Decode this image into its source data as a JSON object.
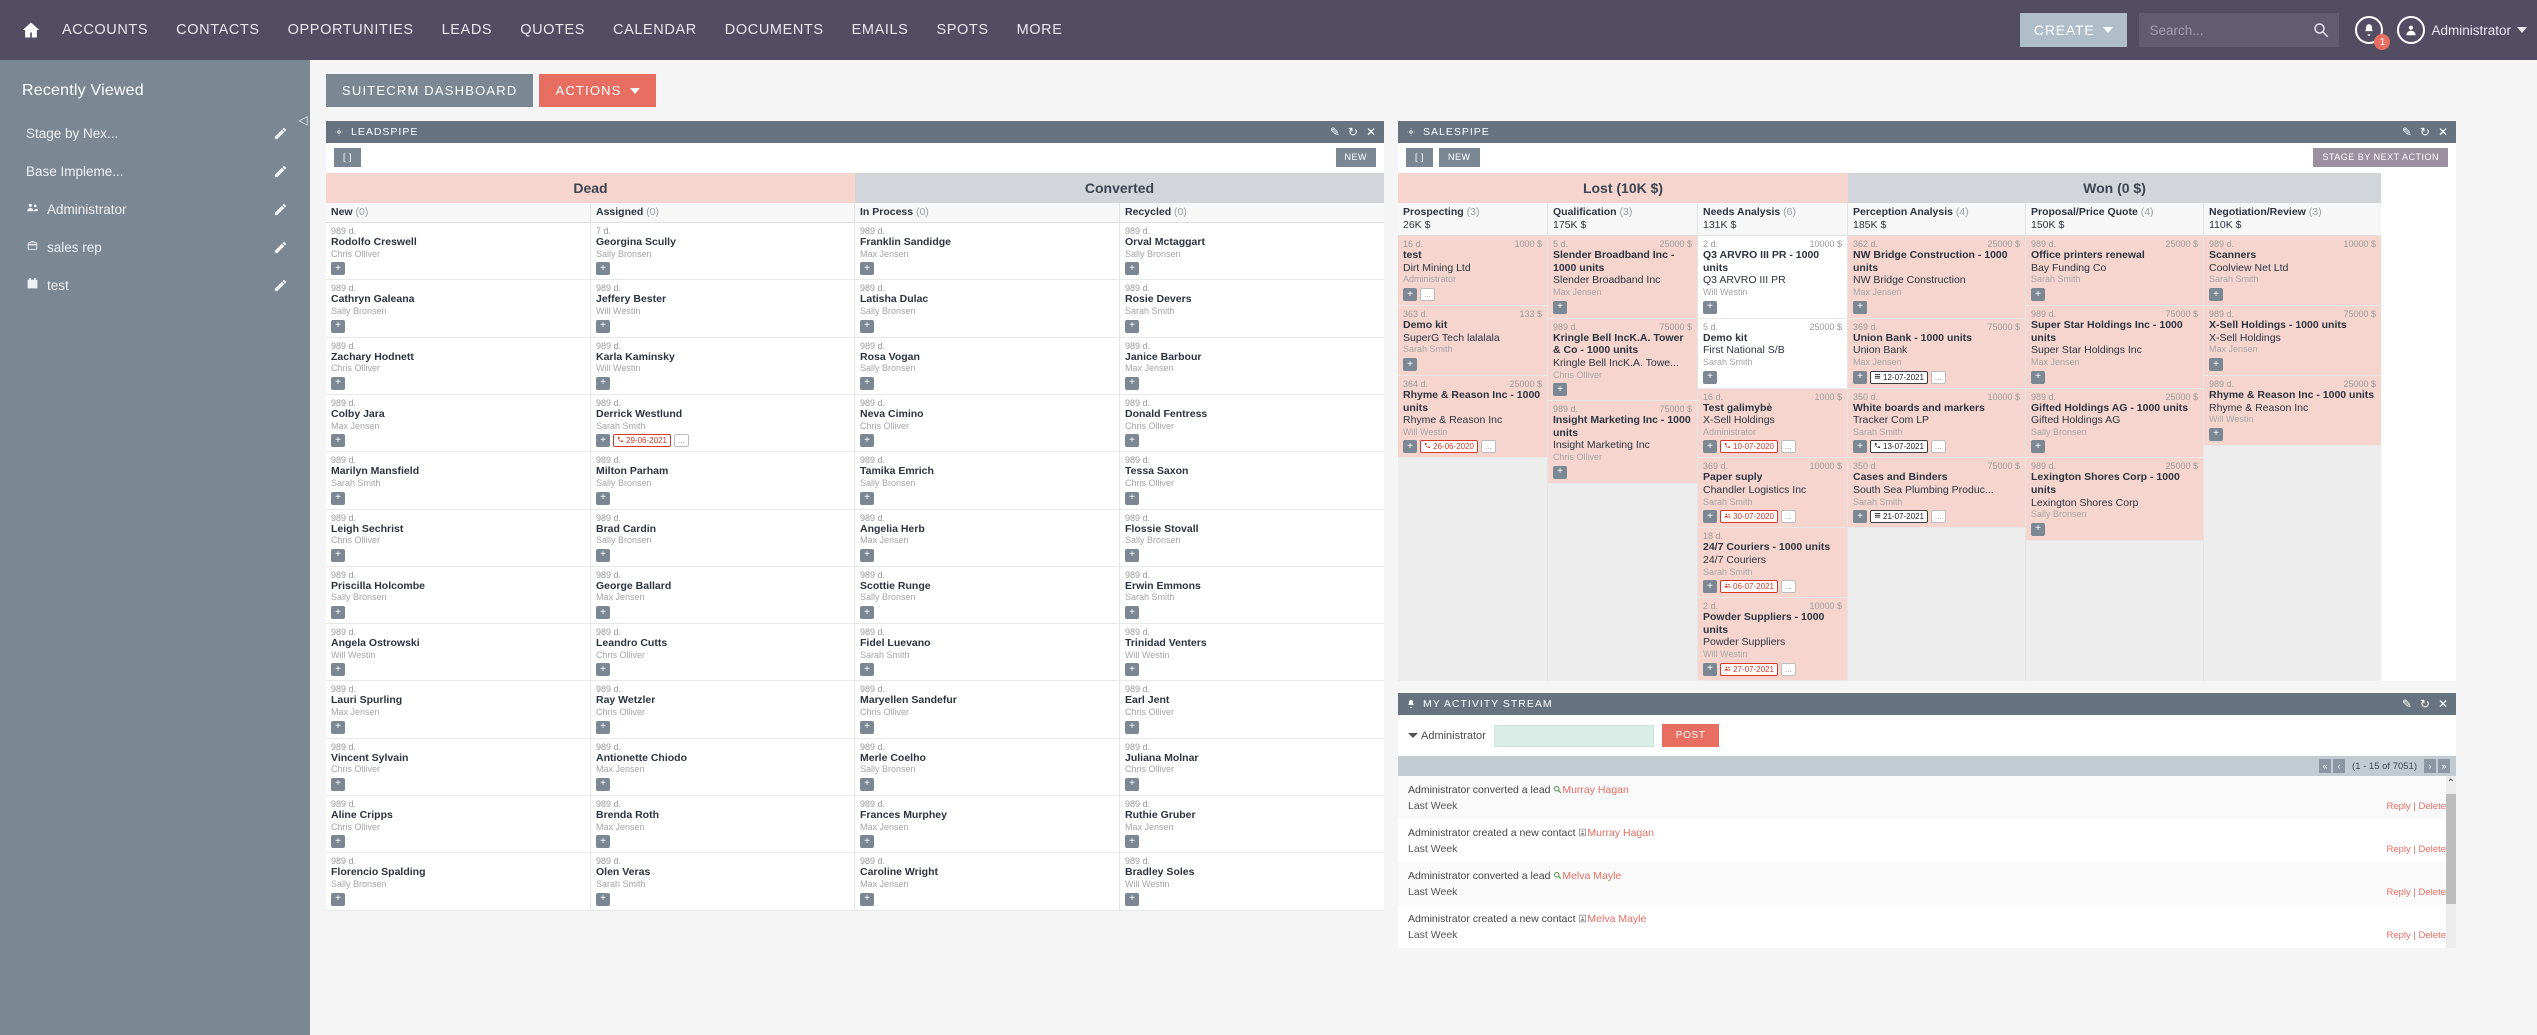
{
  "topnav": {
    "home_icon": "home-icon",
    "links": [
      "ACCOUNTS",
      "CONTACTS",
      "OPPORTUNITIES",
      "LEADS",
      "QUOTES",
      "CALENDAR",
      "DOCUMENTS",
      "EMAILS",
      "SPOTS",
      "MORE"
    ],
    "create_label": "CREATE",
    "search_placeholder": "Search...",
    "search_value": "",
    "notification_count": "1",
    "user_label": "Administrator",
    "bg_color": "#534d64",
    "create_bg": "#b0bec9"
  },
  "sidebar": {
    "title": "Recently Viewed",
    "items": [
      {
        "label": "Stage by Nex...",
        "icon": ""
      },
      {
        "label": "Base Impleme...",
        "icon": ""
      },
      {
        "label": "Administrator",
        "icon": "users-icon"
      },
      {
        "label": "sales rep",
        "icon": "briefcase-icon"
      },
      {
        "label": "test",
        "icon": "calendar-icon"
      }
    ],
    "bg_color": "#7c8794"
  },
  "tabs": [
    {
      "label": "SUITECRM DASHBOARD",
      "active": true
    },
    {
      "label": "ACTIONS",
      "dropdown": true
    }
  ],
  "leadspipe": {
    "title": "LEADSPIPE",
    "toolbar": {
      "brackets": "[ ]",
      "new_label": "NEW"
    },
    "groups": [
      {
        "label": "Dead",
        "style": "lost"
      },
      {
        "label": "Converted",
        "style": "won"
      }
    ],
    "columns": [
      {
        "name": "New",
        "count": "(0)",
        "cards": [
          {
            "age": "989 d.",
            "title": "Rodolfo Creswell",
            "user": "Chris Olliver"
          },
          {
            "age": "989 d.",
            "title": "Cathryn Galeana",
            "user": "Sally Bronsen"
          },
          {
            "age": "989 d.",
            "title": "Zachary Hodnett",
            "user": "Chris Olliver"
          },
          {
            "age": "989 d.",
            "title": "Colby Jara",
            "user": "Max Jensen"
          },
          {
            "age": "989 d.",
            "title": "Marilyn Mansfield",
            "user": "Sarah Smith"
          },
          {
            "age": "989 d.",
            "title": "Leigh Sechrist",
            "user": "Chris Olliver"
          },
          {
            "age": "989 d.",
            "title": "Priscilla Holcombe",
            "user": "Sally Bronsen"
          },
          {
            "age": "989 d.",
            "title": "Angela Ostrowski",
            "user": "Will Westin"
          },
          {
            "age": "989 d.",
            "title": "Lauri Spurling",
            "user": "Max Jensen"
          },
          {
            "age": "989 d.",
            "title": "Vincent Sylvain",
            "user": "Chris Olliver"
          },
          {
            "age": "989 d.",
            "title": "Aline Cripps",
            "user": "Chris Olliver"
          },
          {
            "age": "989 d.",
            "title": "Florencio Spalding",
            "user": "Sally Bronsen"
          }
        ]
      },
      {
        "name": "Assigned",
        "count": "(0)",
        "cards": [
          {
            "age": "7 d.",
            "title": "Georgina Scully",
            "user": "Sally Bronsen"
          },
          {
            "age": "989 d.",
            "title": "Jeffery Bester",
            "user": "Will Westin"
          },
          {
            "age": "989 d.",
            "title": "Karla Kaminsky",
            "user": "Will Westin"
          },
          {
            "age": "989 d.",
            "title": "Derrick Westlund",
            "user": "Sarah Smith",
            "date": "29-06-2021",
            "date_icon": "phone-icon",
            "dots": true
          },
          {
            "age": "989 d.",
            "title": "Milton Parham",
            "user": "Sally Bronsen"
          },
          {
            "age": "989 d.",
            "title": "Brad Cardin",
            "user": "Sally Bronsen"
          },
          {
            "age": "989 d.",
            "title": "George Ballard",
            "user": "Max Jensen"
          },
          {
            "age": "989 d.",
            "title": "Leandro Cutts",
            "user": "Chris Olliver"
          },
          {
            "age": "989 d.",
            "title": "Ray Wetzler",
            "user": "Chris Olliver"
          },
          {
            "age": "989 d.",
            "title": "Antionette Chiodo",
            "user": "Max Jensen"
          },
          {
            "age": "989 d.",
            "title": "Brenda Roth",
            "user": "Max Jensen"
          },
          {
            "age": "989 d.",
            "title": "Olen Veras",
            "user": "Sarah Smith"
          }
        ]
      },
      {
        "name": "In Process",
        "count": "(0)",
        "cards": [
          {
            "age": "989 d.",
            "title": "Franklin Sandidge",
            "user": "Max Jensen"
          },
          {
            "age": "989 d.",
            "title": "Latisha Dulac",
            "user": "Sally Bronsen"
          },
          {
            "age": "989 d.",
            "title": "Rosa Vogan",
            "user": "Sally Bronsen"
          },
          {
            "age": "989 d.",
            "title": "Neva Cimino",
            "user": "Chris Olliver"
          },
          {
            "age": "989 d.",
            "title": "Tamika Emrich",
            "user": "Sally Bronsen"
          },
          {
            "age": "989 d.",
            "title": "Angelia Herb",
            "user": "Max Jensen"
          },
          {
            "age": "989 d.",
            "title": "Scottie Runge",
            "user": "Sally Bronsen"
          },
          {
            "age": "989 d.",
            "title": "Fidel Luevano",
            "user": "Sarah Smith"
          },
          {
            "age": "989 d.",
            "title": "Maryellen Sandefur",
            "user": "Chris Olliver"
          },
          {
            "age": "989 d.",
            "title": "Merle Coelho",
            "user": "Sally Bronsen"
          },
          {
            "age": "989 d.",
            "title": "Frances Murphey",
            "user": "Max Jensen"
          },
          {
            "age": "989 d.",
            "title": "Caroline Wright",
            "user": "Max Jensen"
          }
        ]
      },
      {
        "name": "Recycled",
        "count": "(0)",
        "cards": [
          {
            "age": "989 d.",
            "title": "Orval Mctaggart",
            "user": "Sally Bronsen"
          },
          {
            "age": "989 d.",
            "title": "Rosie Devers",
            "user": "Sarah Smith"
          },
          {
            "age": "989 d.",
            "title": "Janice Barbour",
            "user": "Max Jensen"
          },
          {
            "age": "989 d.",
            "title": "Donald Fentress",
            "user": "Chris Olliver"
          },
          {
            "age": "989 d.",
            "title": "Tessa Saxon",
            "user": "Chris Olliver"
          },
          {
            "age": "989 d.",
            "title": "Flossie Stovall",
            "user": "Sally Bronsen"
          },
          {
            "age": "989 d.",
            "title": "Erwin Emmons",
            "user": "Sarah Smith"
          },
          {
            "age": "989 d.",
            "title": "Trinidad Venters",
            "user": "Will Westin"
          },
          {
            "age": "989 d.",
            "title": "Earl Jent",
            "user": "Chris Olliver"
          },
          {
            "age": "989 d.",
            "title": "Juliana Molnar",
            "user": "Chris Olliver"
          },
          {
            "age": "989 d.",
            "title": "Ruthie Gruber",
            "user": "Max Jensen"
          },
          {
            "age": "989 d.",
            "title": "Bradley Soles",
            "user": "Will Westin"
          }
        ]
      }
    ]
  },
  "salespipe": {
    "title": "SALESPIPE",
    "toolbar": {
      "brackets": "[ ]",
      "new_label": "NEW",
      "stage_label": "STAGE BY NEXT ACTION"
    },
    "groups": [
      {
        "label": "Lost (10K $)",
        "style": "lost"
      },
      {
        "label": "Won (0 $)",
        "style": "won"
      }
    ],
    "columns": [
      {
        "name": "Prospecting",
        "count": "(3)",
        "amount": "26K $",
        "cards": [
          {
            "age": "16 d.",
            "value": "1000 $",
            "title": "test",
            "sub": "Dirt Mining Ltd",
            "user": "Administrator",
            "bg": "pink",
            "dots": true
          },
          {
            "age": "363 d.",
            "value": "133 $",
            "title": "Demo kit",
            "sub": "SuperG Tech lalalala",
            "user": "Sarah Smith",
            "bg": "pink"
          },
          {
            "age": "364 d.",
            "value": "25000 $",
            "title": "Rhyme & Reason Inc - 1000 units",
            "sub": "Rhyme & Reason Inc",
            "user": "Will Westin",
            "bg": "pink",
            "date": "26-06-2020",
            "date_icon": "phone-icon",
            "dots": true
          }
        ]
      },
      {
        "name": "Qualification",
        "count": "(3)",
        "amount": "175K $",
        "cards": [
          {
            "age": "5 d.",
            "value": "25000 $",
            "title": "Slender Broadband Inc - 1000 units",
            "sub": "Slender Broadband Inc",
            "user": "Max Jensen",
            "bg": "pink"
          },
          {
            "age": "989 d.",
            "value": "75000 $",
            "title": "Kringle Bell IncK.A. Tower & Co - 1000 units",
            "sub": "Kringle Bell IncK.A. Towe...",
            "user": "Chris Olliver",
            "bg": "pink"
          },
          {
            "age": "989 d.",
            "value": "75000 $",
            "title": "Insight Marketing Inc - 1000 units",
            "sub": "Insight Marketing Inc",
            "user": "Chris Olliver",
            "bg": "pink"
          }
        ]
      },
      {
        "name": "Needs Analysis",
        "count": "(6)",
        "amount": "131K $",
        "cards": [
          {
            "age": "2 d.",
            "value": "10000 $",
            "title": "Q3 ARVRO III PR - 1000 units",
            "sub": "Q3 ARVRO III PR",
            "user": "Will Westin",
            "bg": "white"
          },
          {
            "age": "5 d.",
            "value": "25000 $",
            "title": "Demo kit",
            "sub": "First National S/B",
            "user": "Sarah Smith",
            "bg": "white"
          },
          {
            "age": "16 d.",
            "value": "1000 $",
            "title": "Test galimybė",
            "sub": "X-Sell Holdings",
            "user": "Administrator",
            "bg": "pink",
            "date": "10-07-2020",
            "date_icon": "phone-icon",
            "dots": true
          },
          {
            "age": "369 d.",
            "value": "10000 $",
            "title": "Paper suply",
            "sub": "Chandler Logistics Inc",
            "user": "Sarah Smith",
            "bg": "pink",
            "date": "30-07-2020",
            "date_icon": "meeting-icon",
            "dots": true
          },
          {
            "age": "18 d.",
            "value": "",
            "title": "24/7 Couriers - 1000 units",
            "sub": "24/7 Couriers",
            "user": "Sarah Smith",
            "bg": "pink",
            "date": "06-07-2021",
            "date_icon": "meeting-icon",
            "dots": true
          },
          {
            "age": "2 d.",
            "value": "10000 $",
            "title": "Powder Suppliers - 1000 units",
            "sub": "Powder Suppliers",
            "user": "Will Westin",
            "bg": "pink",
            "date": "27-07-2021",
            "date_icon": "meeting-icon",
            "dots": true
          }
        ]
      },
      {
        "name": "Perception Analysis",
        "count": "(4)",
        "amount": "185K $",
        "cards": [
          {
            "age": "362 d.",
            "value": "25000 $",
            "title": "NW Bridge Construction - 1000 units",
            "sub": "NW Bridge Construction",
            "user": "Max Jensen",
            "bg": "pink"
          },
          {
            "age": "369 d.",
            "value": "75000 $",
            "title": "Union Bank - 1000 units",
            "sub": "Union Bank",
            "user": "Max Jensen",
            "bg": "pink",
            "date": "12-07-2021",
            "date_icon": "task-icon",
            "date_style": "dark",
            "dots": true
          },
          {
            "age": "350 d.",
            "value": "10000 $",
            "title": "White boards and markers",
            "sub": "Tracker Com LP",
            "user": "Sarah Smith",
            "bg": "pink",
            "date": "13-07-2021",
            "date_icon": "phone-icon",
            "date_style": "dark",
            "dots": true
          },
          {
            "age": "350 d.",
            "value": "75000 $",
            "title": "Cases and Binders",
            "sub": "South Sea Plumbing Produc...",
            "user": "Sarah Smith",
            "bg": "pink",
            "date": "21-07-2021",
            "date_icon": "task-icon",
            "date_style": "dark",
            "dots": true
          }
        ]
      },
      {
        "name": "Proposal/Price Quote",
        "count": "(4)",
        "amount": "150K $",
        "cards": [
          {
            "age": "989 d.",
            "value": "25000 $",
            "title": "Office printers renewal",
            "sub": "Bay Funding Co",
            "user": "Sarah Smith",
            "bg": "pink"
          },
          {
            "age": "989 d.",
            "value": "75000 $",
            "title": "Super Star Holdings Inc - 1000 units",
            "sub": "Super Star Holdings Inc",
            "user": "Max Jensen",
            "bg": "pink"
          },
          {
            "age": "989 d.",
            "value": "25000 $",
            "title": "Gifted Holdings AG - 1000 units",
            "sub": "Gifted Holdings AG",
            "user": "Sally Bronsen",
            "bg": "pink"
          },
          {
            "age": "989 d.",
            "value": "25000 $",
            "title": "Lexington Shores Corp - 1000 units",
            "sub": "Lexington Shores Corp",
            "user": "Sally Bronsen",
            "bg": "pink"
          }
        ]
      },
      {
        "name": "Negotiation/Review",
        "count": "(3)",
        "amount": "110K $",
        "cards": [
          {
            "age": "989 d.",
            "value": "10000 $",
            "title": "Scanners",
            "sub": "Coolview Net Ltd",
            "user": "Sarah Smith",
            "bg": "pink"
          },
          {
            "age": "989 d.",
            "value": "75000 $",
            "title": "X-Sell Holdings - 1000 units",
            "sub": "X-Sell Holdings",
            "user": "Max Jensen",
            "bg": "pink"
          },
          {
            "age": "989 d.",
            "value": "25000 $",
            "title": "Rhyme & Reason Inc - 1000 units",
            "sub": "Rhyme & Reason Inc",
            "user": "Will Westin",
            "bg": "pink"
          }
        ]
      }
    ]
  },
  "activity_stream": {
    "title": "MY ACTIVITY STREAM",
    "user_label": "Administrator",
    "post_value": "",
    "post_label": "POST",
    "pagination": "(1 - 15 of 7051)",
    "rows": [
      {
        "text": "Administrator converted a lead",
        "icon": "lead-convert-icon",
        "link": "Murray Hagan",
        "time": "Last Week",
        "reply": "Reply",
        "delete": "Delete"
      },
      {
        "text": "Administrator created a new contact",
        "icon": "contact-icon",
        "link": "Murray Hagan",
        "time": "Last Week",
        "reply": "Reply",
        "delete": "Delete"
      },
      {
        "text": "Administrator converted a lead",
        "icon": "lead-convert-icon",
        "link": "Melva Mayle",
        "time": "Last Week",
        "reply": "Reply",
        "delete": "Delete"
      },
      {
        "text": "Administrator created a new contact",
        "icon": "contact-icon",
        "link": "Melva Mayle",
        "time": "Last Week",
        "reply": "Reply",
        "delete": "Delete"
      }
    ]
  }
}
